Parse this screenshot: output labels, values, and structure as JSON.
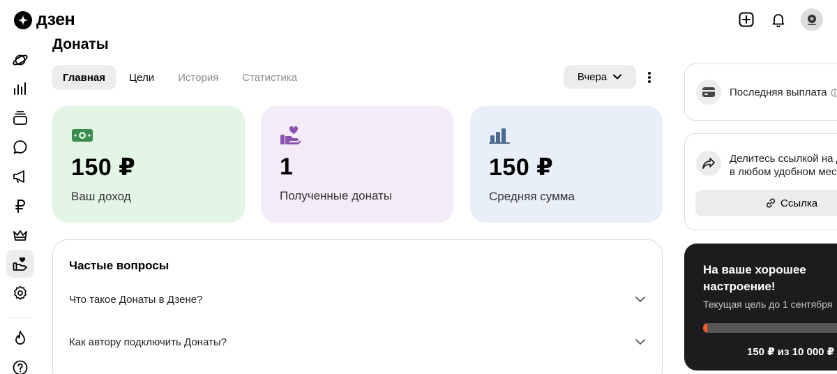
{
  "brand": {
    "name": "дзен"
  },
  "header": {
    "icons": [
      "add-icon",
      "bell-icon",
      "avatar"
    ]
  },
  "sidebar": {
    "items": [
      {
        "name": "planet-icon"
      },
      {
        "name": "bar-chart-icon"
      },
      {
        "name": "stack-icon"
      },
      {
        "name": "chat-icon"
      },
      {
        "name": "megaphone-icon"
      },
      {
        "name": "ruble-icon"
      },
      {
        "name": "crown-icon"
      },
      {
        "name": "hand-heart-icon",
        "active": true
      },
      {
        "name": "gear-icon"
      },
      {
        "name": "fire-icon"
      },
      {
        "name": "help-icon"
      }
    ]
  },
  "page": {
    "title": "Донаты"
  },
  "tabs": [
    {
      "label": "Главная",
      "state": "active"
    },
    {
      "label": "Цели",
      "state": "normal"
    },
    {
      "label": "История",
      "state": "muted"
    },
    {
      "label": "Статистика",
      "state": "muted"
    }
  ],
  "period": {
    "label": "Вчера"
  },
  "stats": [
    {
      "value": "150 ₽",
      "label": "Ваш доход",
      "icon": "money-icon",
      "bg": "#e3f6e6",
      "icon_color": "#3a8c4f"
    },
    {
      "value": "1",
      "label": "Полученные донаты",
      "icon": "hand-heart-icon",
      "bg": "#f3ecf8",
      "icon_color": "#8a55b0"
    },
    {
      "value": "150 ₽",
      "label": "Средняя сумма",
      "icon": "bar-chart-icon",
      "bg": "#e9eff9",
      "icon_color": "#4c6a8c"
    }
  ],
  "faq": {
    "title": "Частые вопросы",
    "items": [
      {
        "question": "Что такое Донаты в Дзене?"
      },
      {
        "question": "Как автору подключить Донаты?"
      }
    ]
  },
  "payout": {
    "label": "Последняя выплата"
  },
  "share": {
    "text_line1": "Делитесь ссылкой на д",
    "text_line2": "в любом удобном мес",
    "link_label": "Ссылка"
  },
  "goal": {
    "title": "На ваше хорошее настроение!",
    "subtitle": "Текущая цель до 1 сентября",
    "progress": 0.015,
    "amount": "150 ₽ из 10 000 ₽"
  },
  "colors": {
    "accent": "#ff5b2a",
    "goal_bg": "#1c1c1e"
  }
}
